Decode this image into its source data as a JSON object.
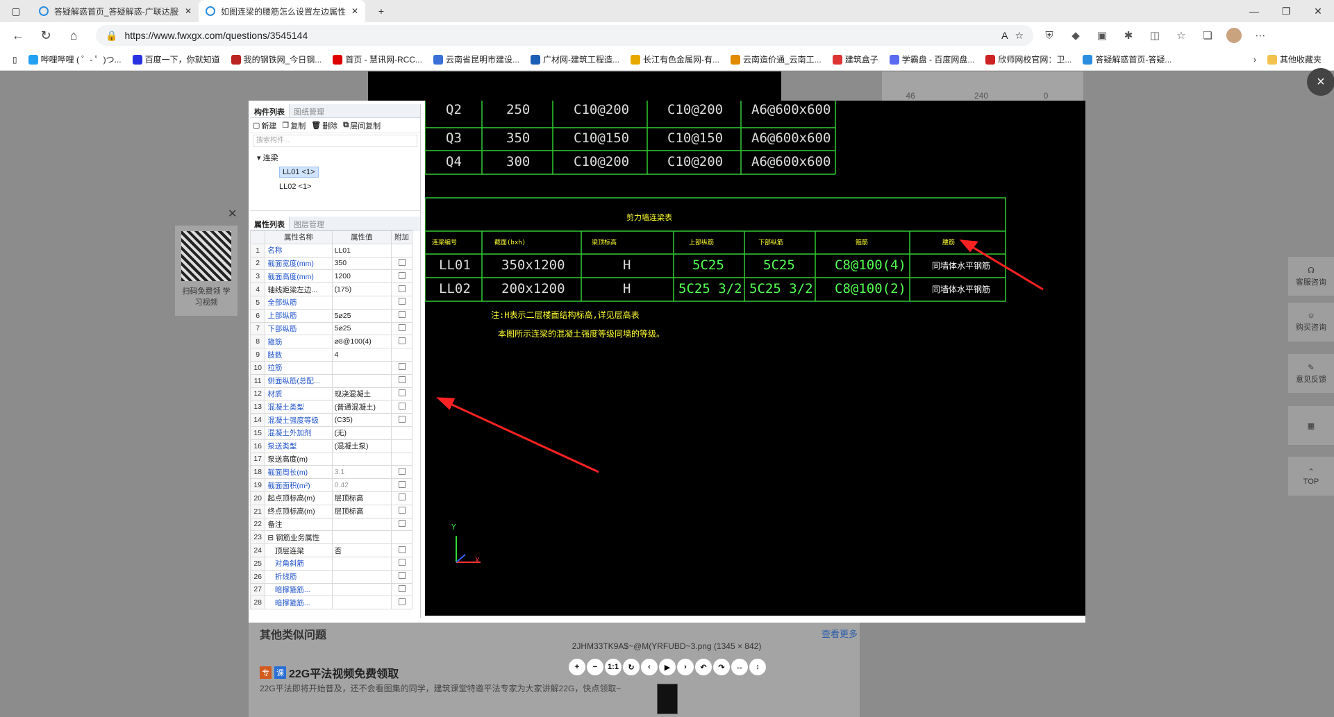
{
  "browser": {
    "tabs": [
      {
        "label": "答疑解惑首页_答疑解惑-广联达服务新干线",
        "active": false
      },
      {
        "label": "如图连梁的腰筋怎么设置左边属性",
        "active": true
      }
    ],
    "new_tab": "+",
    "url": "https://www.fwxgx.com/questions/3545144",
    "window_controls": {
      "minimize": "—",
      "restore": "❐",
      "close": "✕"
    },
    "bookmarks": [
      "哔哩哔哩 ( ゜- ゜)つ...",
      "百度一下，你就知道",
      "我的钢铁网_今日钢...",
      "首页 - 慧讯网-RCC...",
      "云南省昆明市建设...",
      "广材网-建筑工程造...",
      "长江有色金属网-有...",
      "云南造价通_云南工...",
      "建筑盒子",
      "学霸盘 - 百度网盘...",
      "欣师网校官网：卫...",
      "答疑解惑首页-答疑..."
    ],
    "other_bookmarks": "其他收藏夹"
  },
  "page": {
    "stats": [
      "46",
      "240",
      "0"
    ],
    "qr_text": "扫码免费领 学习视频",
    "similar_title": "其他类似问题",
    "see_more": "查看更多",
    "badge1": "专",
    "badge2": "课",
    "promo_title": "22G平法视频免费领取",
    "promo_desc": "22G平法即将开始普及，还不会看图集的同学，建筑课堂特邀平法专家为大家讲解22G，快点领取~"
  },
  "sidebar": [
    "客服咨询",
    "购买咨询",
    "意见反馈",
    "",
    "TOP"
  ],
  "viewer": {
    "filename": "2JHM33TK9A$~@M(YRFUBD~3.png (1345 × 842)",
    "controls": [
      "+",
      "−",
      "1:1",
      "↻",
      "‹",
      "▶",
      "›",
      "↶",
      "↷",
      "↔",
      "↕"
    ],
    "close": "×"
  },
  "panel": {
    "tabs1": [
      "构件列表",
      "图纸管理"
    ],
    "toolbar": [
      "新建",
      "复制",
      "删除",
      "层间复制"
    ],
    "search_placeholder": "搜索构件...",
    "tree_root": "连梁",
    "tree_items": [
      "LL01 <1>",
      "LL02 <1>"
    ],
    "tabs2": [
      "属性列表",
      "图层管理"
    ],
    "headers": [
      "属性名称",
      "属性值",
      "附加"
    ],
    "rows": [
      {
        "n": "1",
        "name": "名称",
        "val": "LL01",
        "blue": true,
        "cb": false
      },
      {
        "n": "2",
        "name": "截面宽度(mm)",
        "val": "350",
        "blue": true,
        "cb": true
      },
      {
        "n": "3",
        "name": "截面高度(mm)",
        "val": "1200",
        "blue": true,
        "cb": true
      },
      {
        "n": "4",
        "name": "轴线距梁左边...",
        "val": "(175)",
        "blue": false,
        "cb": true
      },
      {
        "n": "5",
        "name": "全部纵筋",
        "val": "",
        "blue": true,
        "cb": true
      },
      {
        "n": "6",
        "name": "上部纵筋",
        "val": "5⌀25",
        "blue": true,
        "cb": true
      },
      {
        "n": "7",
        "name": "下部纵筋",
        "val": "5⌀25",
        "blue": true,
        "cb": true
      },
      {
        "n": "8",
        "name": "箍筋",
        "val": "⌀8@100(4)",
        "blue": true,
        "cb": true
      },
      {
        "n": "9",
        "name": "肢数",
        "val": "4",
        "blue": true,
        "cb": false
      },
      {
        "n": "10",
        "name": "拉筋",
        "val": "",
        "blue": true,
        "cb": true
      },
      {
        "n": "11",
        "name": "侧面纵筋(总配...",
        "val": "",
        "blue": true,
        "cb": true
      },
      {
        "n": "12",
        "name": "材质",
        "val": "现浇混凝土",
        "blue": true,
        "cb": true
      },
      {
        "n": "13",
        "name": "混凝土类型",
        "val": "(普通混凝土)",
        "blue": true,
        "cb": true
      },
      {
        "n": "14",
        "name": "混凝土强度等级",
        "val": "(C35)",
        "blue": true,
        "cb": true
      },
      {
        "n": "15",
        "name": "混凝土外加剂",
        "val": "(无)",
        "blue": true,
        "cb": false
      },
      {
        "n": "16",
        "name": "泵送类型",
        "val": "(混凝土泵)",
        "blue": true,
        "cb": false
      },
      {
        "n": "17",
        "name": "泵送高度(m)",
        "val": "",
        "blue": false,
        "cb": false
      },
      {
        "n": "18",
        "name": "截面周长(m)",
        "val": "3.1",
        "blue": true,
        "cb": true,
        "gray": true
      },
      {
        "n": "19",
        "name": "截面面积(m²)",
        "val": "0.42",
        "blue": true,
        "cb": true,
        "gray": true
      },
      {
        "n": "20",
        "name": "起点顶标高(m)",
        "val": "层顶标高",
        "blue": false,
        "cb": true
      },
      {
        "n": "21",
        "name": "终点顶标高(m)",
        "val": "层顶标高",
        "blue": false,
        "cb": true
      },
      {
        "n": "22",
        "name": "备注",
        "val": "",
        "blue": false,
        "cb": true
      },
      {
        "n": "23",
        "name": "⊟ 钢筋业务属性",
        "val": "",
        "blue": false,
        "cb": false
      },
      {
        "n": "24",
        "name": "　顶层连梁",
        "val": "否",
        "blue": false,
        "cb": true
      },
      {
        "n": "25",
        "name": "　对角斜筋",
        "val": "",
        "blue": true,
        "cb": true
      },
      {
        "n": "26",
        "name": "　折线筋",
        "val": "",
        "blue": true,
        "cb": true
      },
      {
        "n": "27",
        "name": "　暗撑箍筋...",
        "val": "",
        "blue": true,
        "cb": true
      },
      {
        "n": "28",
        "name": "　暗撑箍筋...",
        "val": "",
        "blue": true,
        "cb": true
      }
    ]
  },
  "cad": {
    "wall_rows": [
      [
        "Q2",
        "250",
        "C10@200",
        "C10@200",
        "A6@600x600"
      ],
      [
        "Q3",
        "350",
        "C10@150",
        "C10@150",
        "A6@600x600"
      ],
      [
        "Q4",
        "300",
        "C10@200",
        "C10@200",
        "A6@600x600"
      ]
    ],
    "beam_title": "剪力墙连梁表",
    "beam_headers": [
      "连梁编号",
      "截面(bxh)",
      "梁顶标高",
      "上部纵筋",
      "下部纵筋",
      "箍筋",
      "腰筋"
    ],
    "beam_rows": [
      [
        "LL01",
        "350x1200",
        "H",
        "5C25",
        "5C25",
        "C8@100(4)",
        "同墙体水平钢筋"
      ],
      [
        "LL02",
        "200x1200",
        "H",
        "5C25 3/2",
        "5C25 3/2",
        "C8@100(2)",
        "同墙体水平钢筋"
      ]
    ],
    "note1": "注:H表示二层楼面结构标高,详见层高表",
    "note2": "本图所示连梁的混凝土强度等级同墙的等级。",
    "axis_y": "Y",
    "axis_x": "X"
  }
}
